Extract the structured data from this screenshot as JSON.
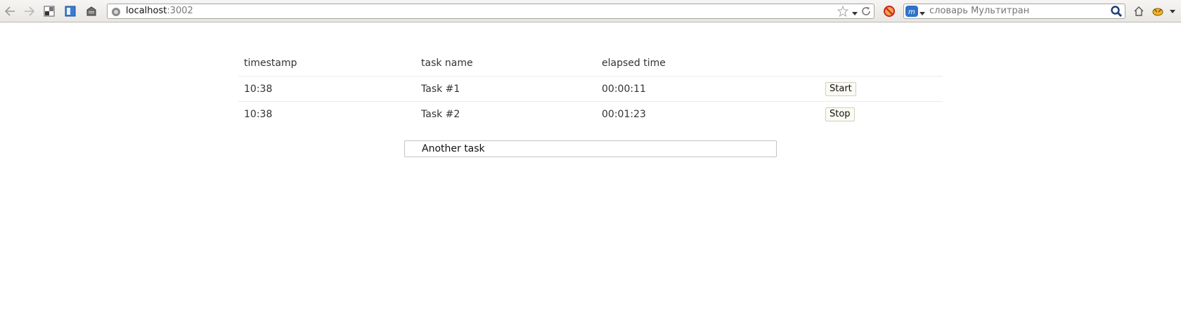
{
  "browser": {
    "url_host": "localhost",
    "url_port": ":3002",
    "search_placeholder": "словарь Мультитран",
    "icons": [
      "back-icon",
      "forward-icon",
      "bookmark-manager-icon",
      "sidebar-icon",
      "addon-icon",
      "globe-icon",
      "star-icon",
      "dropdown-icon",
      "reload-icon",
      "blocker-icon",
      "multitran-icon",
      "magnifier-icon",
      "home-icon",
      "extension-icon",
      "menu-dropdown-icon"
    ]
  },
  "table": {
    "headers": [
      "timestamp",
      "task name",
      "elapsed time"
    ],
    "rows": [
      {
        "timestamp": "10:38",
        "name": "Task #1",
        "elapsed": "00:00:11",
        "action": "Start"
      },
      {
        "timestamp": "10:38",
        "name": "Task #2",
        "elapsed": "00:01:23",
        "action": "Stop"
      }
    ]
  },
  "new_task": {
    "value": "Another task"
  }
}
